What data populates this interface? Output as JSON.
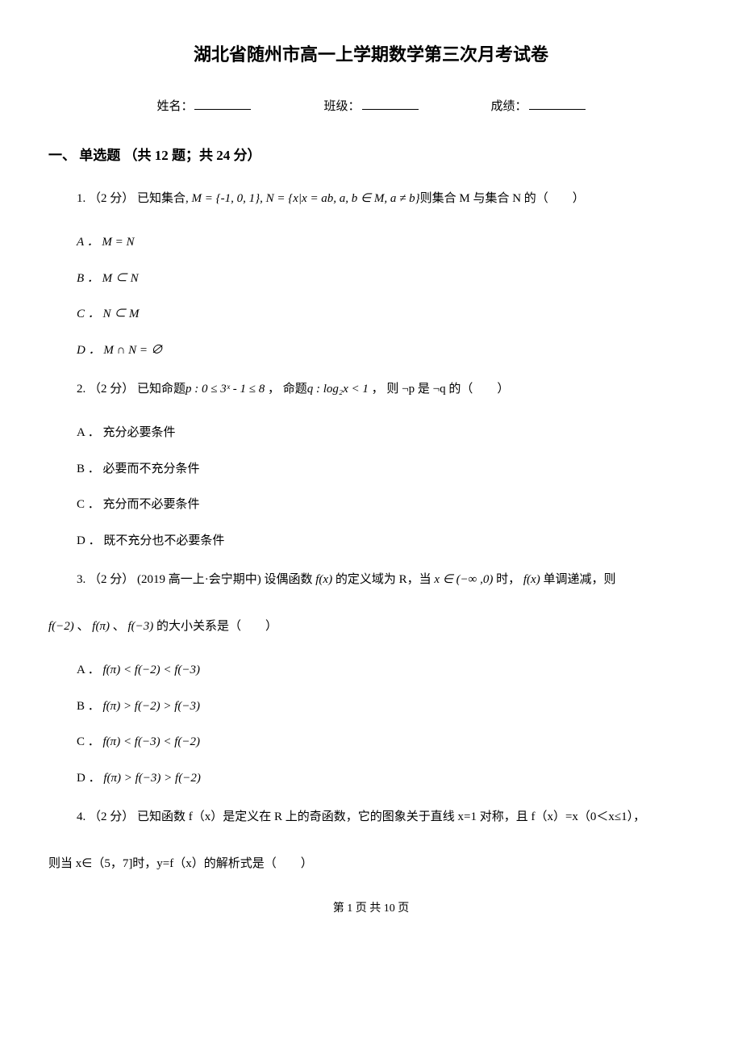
{
  "title": "湖北省随州市高一上学期数学第三次月考试卷",
  "info": {
    "name_label": "姓名：",
    "class_label": "班级：",
    "score_label": "成绩："
  },
  "section1": {
    "header": "一、 单选题 （共 12 题；共 24 分）"
  },
  "q1": {
    "stem_prefix": "1. （2 分） 已知集合, ",
    "stem_math": "M = {-1, 0, 1}, N = {x|x = ab, a, b ∈ M, a ≠ b}",
    "stem_suffix": "则集合 M 与集合 N 的（　　）",
    "optA": "A ． M = N",
    "optB": "B ． M ⊂ N",
    "optC": "C ． N ⊂ M",
    "optD": "D ． M ∩ N = ∅"
  },
  "q2": {
    "stem_a": "2. （2 分）  已知命题",
    "stem_p": "p : 0 ≤ 3ˣ - 1 ≤ 8",
    "stem_b": " ，  命题",
    "stem_q": "q : log₂x < 1",
    "stem_c": " ，  则 ¬p 是 ¬q 的（　　）",
    "optA": "A ． 充分必要条件",
    "optB": "B ． 必要而不充分条件",
    "optC": "C ． 充分而不必要条件",
    "optD": "D ． 既不充分也不必要条件"
  },
  "q3": {
    "stem_a": "3. （2 分） (2019 高一上·会宁期中) 设偶函数 ",
    "stem_fx1": "f(x)",
    "stem_b": " 的定义域为 R，当 ",
    "stem_range": "x ∈ (−∞ ,0)",
    "stem_c": " 时， ",
    "stem_fx2": "f(x)",
    "stem_d": " 单调递减，则",
    "line2_a": "f(−2)",
    "line2_b": " 、 ",
    "line2_c": "f(π)",
    "line2_d": " 、 ",
    "line2_e": "f(−3)",
    "line2_f": " 的大小关系是（　　）",
    "optA_label": "A ． ",
    "optA_math": "f(π) < f(−2) < f(−3)",
    "optB_label": "B ． ",
    "optB_math": "f(π) > f(−2) > f(−3)",
    "optC_label": "C ． ",
    "optC_math": "f(π) < f(−3) < f(−2)",
    "optD_label": "D ． ",
    "optD_math": "f(π) > f(−3) > f(−2)"
  },
  "q4": {
    "line1": "4. （2 分）  已知函数 f（x）是定义在 R 上的奇函数，它的图象关于直线 x=1 对称，且 f（x）=x（0＜x≤1），",
    "line2": "则当 x∈（5，7]时，y=f（x）的解析式是（　　）"
  },
  "footer": "第 1 页 共 10 页"
}
